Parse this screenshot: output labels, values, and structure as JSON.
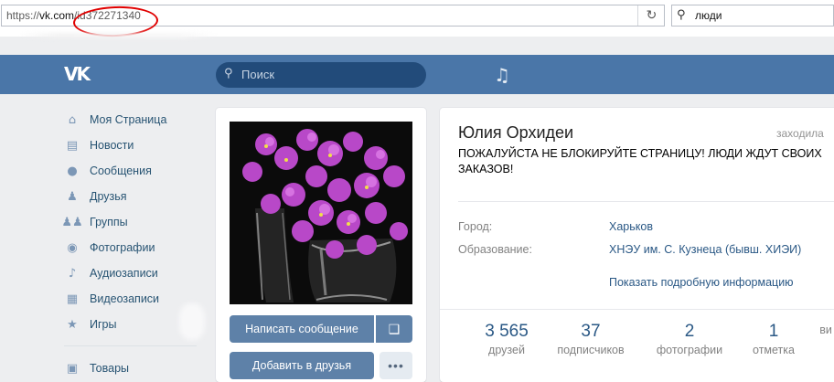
{
  "browser": {
    "url_prefix": "https://",
    "url_domain": "vk.com",
    "url_path": "/id372271340",
    "search_query": "люди",
    "annotation_color": "#e00000"
  },
  "header": {
    "logo": "VK",
    "search_placeholder": "Поиск",
    "brand_color": "#4a76a8"
  },
  "menu": {
    "items": [
      {
        "label": "Моя Страница",
        "icon": "home-icon"
      },
      {
        "label": "Новости",
        "icon": "news-icon"
      },
      {
        "label": "Сообщения",
        "icon": "messages-icon"
      },
      {
        "label": "Друзья",
        "icon": "friends-icon"
      },
      {
        "label": "Группы",
        "icon": "groups-icon"
      },
      {
        "label": "Фотографии",
        "icon": "camera-icon"
      },
      {
        "label": "Аудиозаписи",
        "icon": "music-note-icon"
      },
      {
        "label": "Видеозаписи",
        "icon": "film-icon"
      },
      {
        "label": "Игры",
        "icon": "gamepad-icon"
      },
      {
        "label": "Товары",
        "icon": "bag-icon"
      }
    ]
  },
  "profile": {
    "name": "Юлия Орхидеи",
    "online_status": "заходила",
    "status_text": "ПОЖАЛУЙСТА НЕ БЛОКИРУЙТЕ СТРАНИЦУ! ЛЮДИ ЖДУТ СВОИХ ЗАКАЗОВ!",
    "city_label": "Город:",
    "city_value": "Харьков",
    "education_label": "Образование:",
    "education_value": "ХНЭУ им. С. Кузнеца (бывш. ХИЭИ)",
    "more_info": "Показать подробную информацию",
    "buttons": {
      "message": "Написать сообщение",
      "add_friend": "Добавить в друзья",
      "more": "•••"
    },
    "counters": [
      {
        "count": "3 565",
        "label": "друзей"
      },
      {
        "count": "37",
        "label": "подписчиков"
      },
      {
        "count": "2",
        "label": "фотографии"
      },
      {
        "count": "1",
        "label": "отметка"
      },
      {
        "count": "",
        "label": "ви"
      }
    ]
  }
}
